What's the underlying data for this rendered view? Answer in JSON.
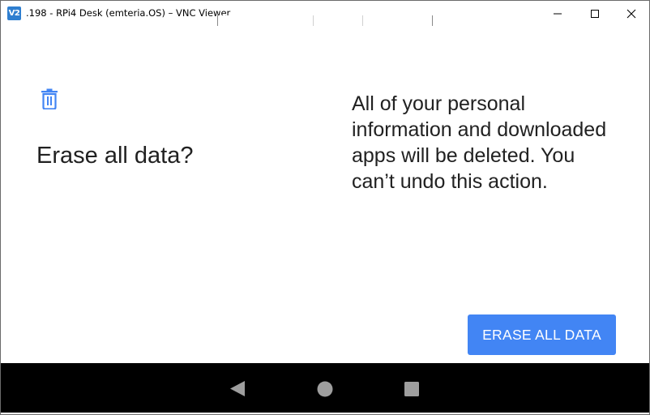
{
  "window": {
    "icon_label": "V2",
    "title": ".198 - RPi4 Desk (emteria.OS) – VNC Viewer",
    "controls": [
      "minimize-icon",
      "maximize-icon",
      "close-icon"
    ]
  },
  "dialog": {
    "icon": "trash-icon",
    "title": "Erase all data?",
    "message": "All of your personal information and downloaded apps will be deleted. You can’t undo this action.",
    "confirm_label": "ERASE ALL DATA",
    "accent_color": "#4285f4"
  },
  "navigation": {
    "buttons": [
      "back-icon",
      "home-icon",
      "recents-icon"
    ]
  }
}
